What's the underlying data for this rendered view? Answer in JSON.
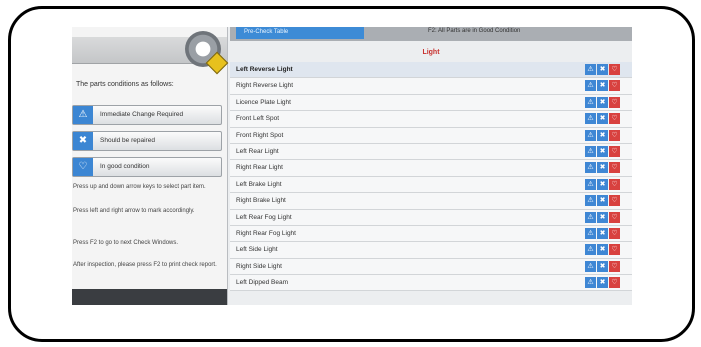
{
  "panel": {
    "intro": "The parts conditions as follows:",
    "legend": [
      {
        "label": "Immediate Change Required",
        "icon": "warning-triangle-icon"
      },
      {
        "label": "Should be repaired",
        "icon": "wrench-cross-icon"
      },
      {
        "label": "In good condition",
        "icon": "heart-icon"
      }
    ],
    "help": [
      "Press up and down arrow keys to select part item.",
      "Press left and right arrow to mark accordingly.",
      "Press F2 to go to next Check Windows.",
      "After inspection, please press F2 to print check report."
    ]
  },
  "topbar": {
    "tab_label": "Pre-Check Table",
    "status": "F2: All Parts are in Good Condition"
  },
  "section": {
    "title": "Light"
  },
  "items": [
    {
      "label": "Left Reverse Light"
    },
    {
      "label": "Right Reverse Light"
    },
    {
      "label": "Licence Plate Light"
    },
    {
      "label": "Front Left Spot"
    },
    {
      "label": "Front Right Spot"
    },
    {
      "label": "Left Rear Light"
    },
    {
      "label": "Right Rear Light"
    },
    {
      "label": "Left Brake Light"
    },
    {
      "label": "Right Brake Light"
    },
    {
      "label": "Left Rear Fog Light"
    },
    {
      "label": "Right Rear Fog Light"
    },
    {
      "label": "Left Side Light"
    },
    {
      "label": "Right Side Light"
    },
    {
      "label": "Left Dipped Beam"
    }
  ],
  "colors": {
    "accent": "#3f87d4",
    "alert": "#d8413f",
    "title": "#c8312e"
  }
}
